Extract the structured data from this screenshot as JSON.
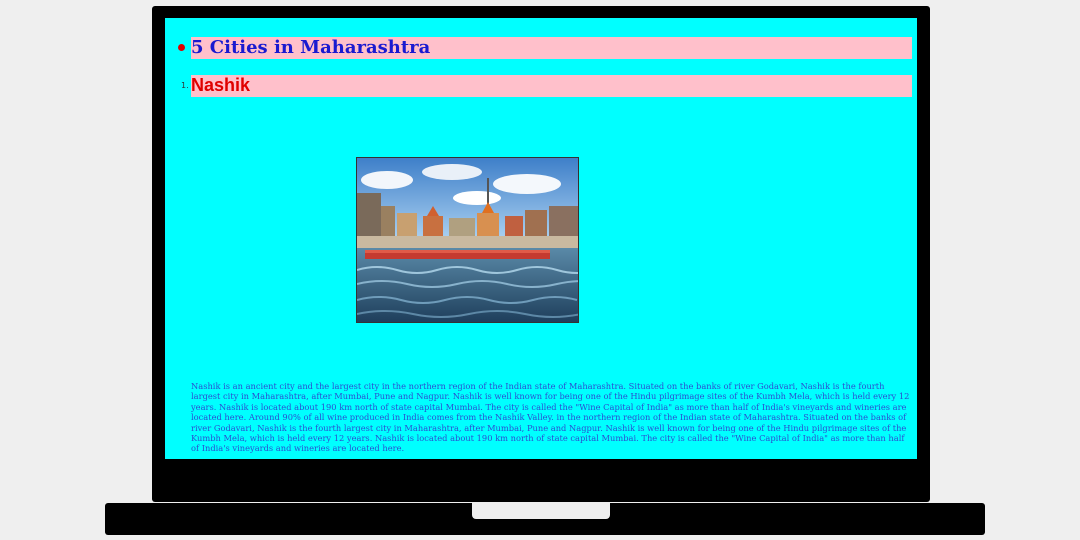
{
  "page": {
    "bullet_heading": "5 Cities in Maharashtra",
    "list_marker": "1.",
    "city_title": "Nashik",
    "paragraph": "Nashik is an ancient city and the largest city in the northern region of the Indian state of Maharashtra. Situated on the banks of river Godavari, Nashik is the fourth largest city in Maharashtra, after Mumbai, Pune and Nagpur. Nashik is well known for being one of the Hindu pilgrimage sites of the Kumbh Mela, which is held every 12 years. Nashik is located about 190 km north of state capital Mumbai. The city is called the \"Wine Capital of India\" as more than half of India's vineyards and wineries are located here. Around 90% of all wine produced in India comes from the Nashik Valley. in the northern region of the Indian state of Maharashtra. Situated on the banks of river Godavari, Nashik is the fourth largest city in Maharashtra, after Mumbai, Pune and Nagpur. Nashik is well known for being one of the Hindu pilgrimage sites of the Kumbh Mela, which is held every 12 years. Nashik is located about 190 km north of state capital Mumbai. The city is called the \"Wine Capital of India\" as more than half of India's vineyards and wineries are located here."
  },
  "colors": {
    "screen_background": "#00ffff",
    "heading_highlight": "#ffc0cb",
    "heading_text": "#1a1ad0",
    "title_text": "#e00000",
    "paragraph_text": "#2a4fd0"
  },
  "icons": {
    "bullet": "bullet-dot-icon"
  }
}
